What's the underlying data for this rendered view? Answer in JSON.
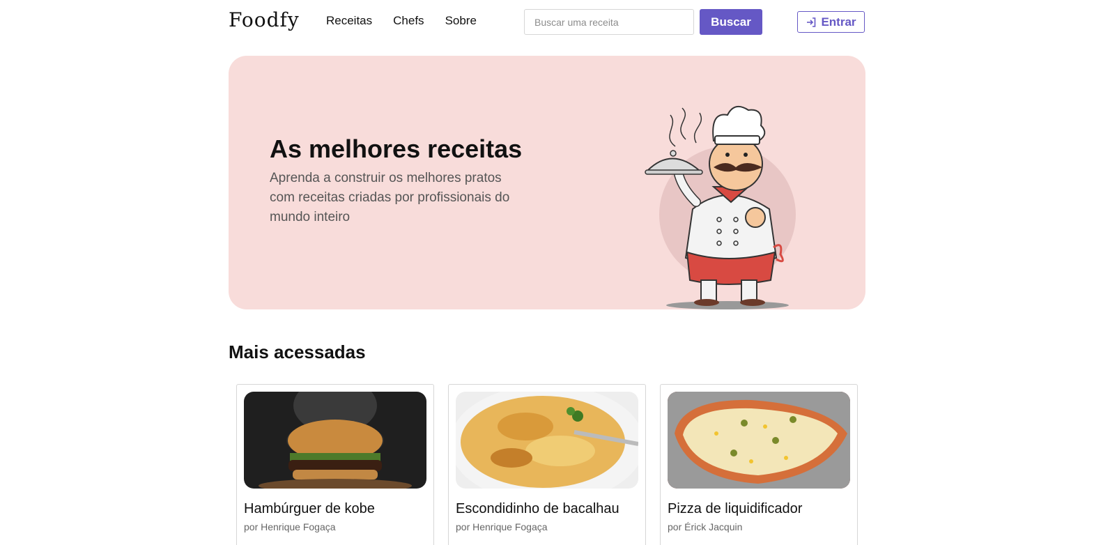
{
  "header": {
    "logo": "Foodfy",
    "nav": [
      "Receitas",
      "Chefs",
      "Sobre"
    ],
    "search_placeholder": "Buscar uma receita",
    "search_button": "Buscar",
    "login_button": "Entrar",
    "login_icon": "login-arrow-icon",
    "accent_color": "#6558c5"
  },
  "hero": {
    "title": "As melhores receitas",
    "text": "Aprenda a construir os melhores pratos com receitas criadas por profissionais do mundo inteiro",
    "background_color": "#f8dcda",
    "illustration": "chef-illustration"
  },
  "section": {
    "title": "Mais acessadas"
  },
  "recipes": [
    {
      "title": "Hambúrguer de kobe",
      "author": "por Henrique Fogaça",
      "image": "hamburger-photo"
    },
    {
      "title": "Escondidinho de bacalhau",
      "author": "por Henrique Fogaça",
      "image": "escondidinho-photo"
    },
    {
      "title": "Pizza de liquidificador",
      "author": "por Érick Jacquin",
      "image": "pizza-photo"
    }
  ]
}
